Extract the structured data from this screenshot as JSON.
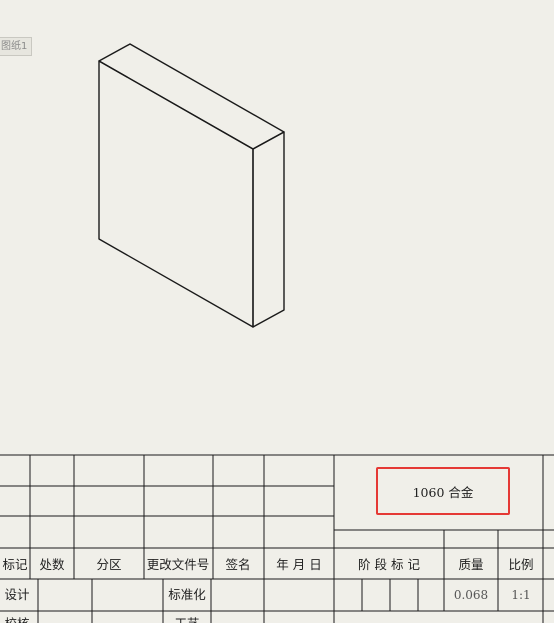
{
  "sheet_tab": {
    "label": "图纸1"
  },
  "title_block": {
    "headers": [
      "标记",
      "处数",
      "分区",
      "更改文件号",
      "签名",
      "年 月 日"
    ],
    "row_design": {
      "label": "设计",
      "std_label": "标准化"
    },
    "row_check": {
      "label": "校核",
      "process_label": "工艺"
    },
    "material": "1060 合金",
    "stage_label": "阶 段 标 记",
    "mass_label": "质量",
    "scale_label": "比例",
    "mass_value": "0.068",
    "scale_value": "1:1"
  },
  "colors": {
    "background": "#f0efe9",
    "line": "#1a1a1a",
    "highlight": "#e53935"
  }
}
